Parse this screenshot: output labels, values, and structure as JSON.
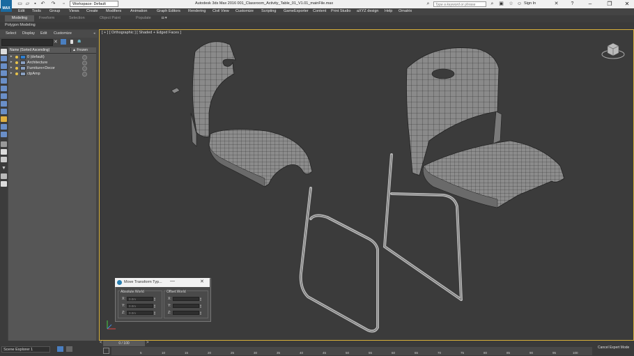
{
  "titlebar": {
    "app_icon_label": "MAX",
    "workspace": "Workspace: Default",
    "app_title": "Autodesk 3ds Max 2016     001_Classroom_Activity_Table_01_V1.01_mainFile.max",
    "search_placeholder": "Type a keyword or phrase",
    "sign_in": "Sign In"
  },
  "menubar": {
    "items": [
      "Edit",
      "Tools",
      "Group",
      "Views",
      "Create",
      "Modifiers",
      "Animation",
      "Graph Editors",
      "Rendering",
      "Civil View",
      "Customize",
      "Scripting",
      "GameExporter",
      "Content",
      "Print Studio",
      "aXYZ design",
      "Help",
      "Omatrix"
    ]
  },
  "ribbon": {
    "tabs": [
      "Modeling",
      "Freeform",
      "Selection",
      "Object Paint",
      "Populate"
    ],
    "panel_label": "Polygon Modeling"
  },
  "scene_explorer": {
    "menu": [
      "Select",
      "Display",
      "Edit",
      "Customize"
    ],
    "columns": {
      "name": "Name (Sorted Ascending)",
      "frozen": "▲ Frozen"
    },
    "rows": [
      {
        "label": "0 (default)"
      },
      {
        "label": "Architecture"
      },
      {
        "label": "Furniture+Decor"
      },
      {
        "label": "ctpAmp"
      }
    ]
  },
  "viewport": {
    "label": "[ + ] [ Orthographic ] [ Shaded + Edged Faces ]"
  },
  "dialog": {
    "title": "Move Transform Typ...",
    "absolute_label": "Absolute:World",
    "offset_label": "Offset:World",
    "axes": [
      "X:",
      "Y:",
      "Z:"
    ],
    "absolute_values": [
      "0.0m",
      "0.0m",
      "0.0m"
    ],
    "offset_values": [
      "",
      "",
      ""
    ]
  },
  "bottom": {
    "scene_explorer_label": "Scene Explorer 1",
    "time_slider": "0 / 100",
    "ticks": [
      "5",
      "10",
      "15",
      "20",
      "25",
      "30",
      "35",
      "40",
      "45",
      "50",
      "55",
      "60",
      "65",
      "70",
      "75",
      "80",
      "85",
      "90",
      "95",
      "100"
    ],
    "cancel_expert": "Cancel Expert Mode"
  }
}
